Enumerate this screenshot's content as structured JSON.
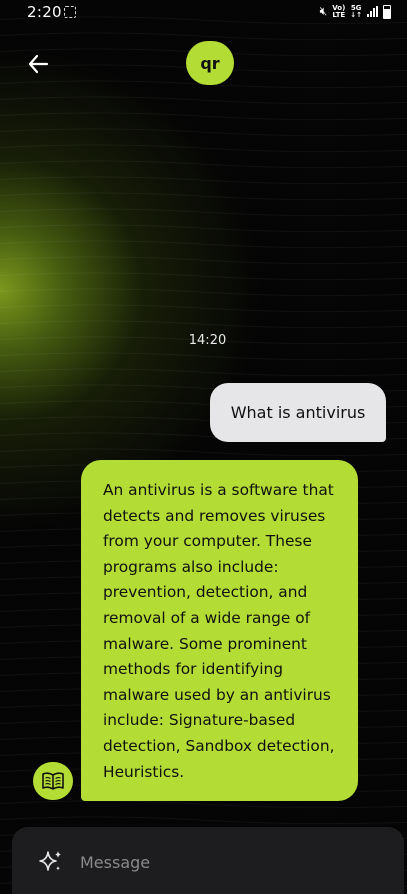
{
  "status_bar": {
    "time": "2:20",
    "network_top": "Vo)",
    "network_bottom": "LTE",
    "network_gen_top": "5G",
    "network_gen_bottom": "↓↑"
  },
  "header": {
    "avatar_text": "qr",
    "back_icon": "arrow-left-icon"
  },
  "conversation": {
    "timestamp": "14:20",
    "messages": [
      {
        "role": "user",
        "text": "What is antivirus"
      },
      {
        "role": "assistant",
        "text": "An antivirus is a software that detects and removes viruses from your computer. These programs also include: prevention, detection, and removal of a wide range of malware. Some prominent methods for identifying malware used by an antivirus include: Signature-based detection, Sandbox detection, Heuristics."
      }
    ]
  },
  "composer": {
    "placeholder": "Message",
    "icon": "sparkle-icon"
  },
  "colors": {
    "accent": "#b3dd34",
    "user_bubble": "#e6e6e8",
    "background": "#050505",
    "composer": "#1d1d1f"
  }
}
